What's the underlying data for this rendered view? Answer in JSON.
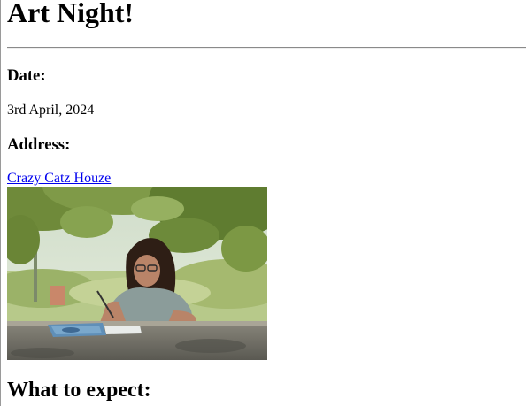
{
  "event": {
    "title": "Art Night!",
    "date_heading": "Date:",
    "date_value": "3rd April, 2024",
    "address_heading": "Address:",
    "address_link": "Crazy Catz Houze",
    "expect_heading": "What to expect:"
  },
  "photo": {
    "icon": "photo-of-woman-painting-outdoors",
    "colors": {
      "foliage_dark": "#5c7a2e",
      "foliage_light": "#a8c06a",
      "sky": "#dfe8dc",
      "table": "#6b6a63",
      "shirt": "#8fa0a0",
      "hair": "#2b1c14",
      "skin": "#b98468"
    }
  }
}
